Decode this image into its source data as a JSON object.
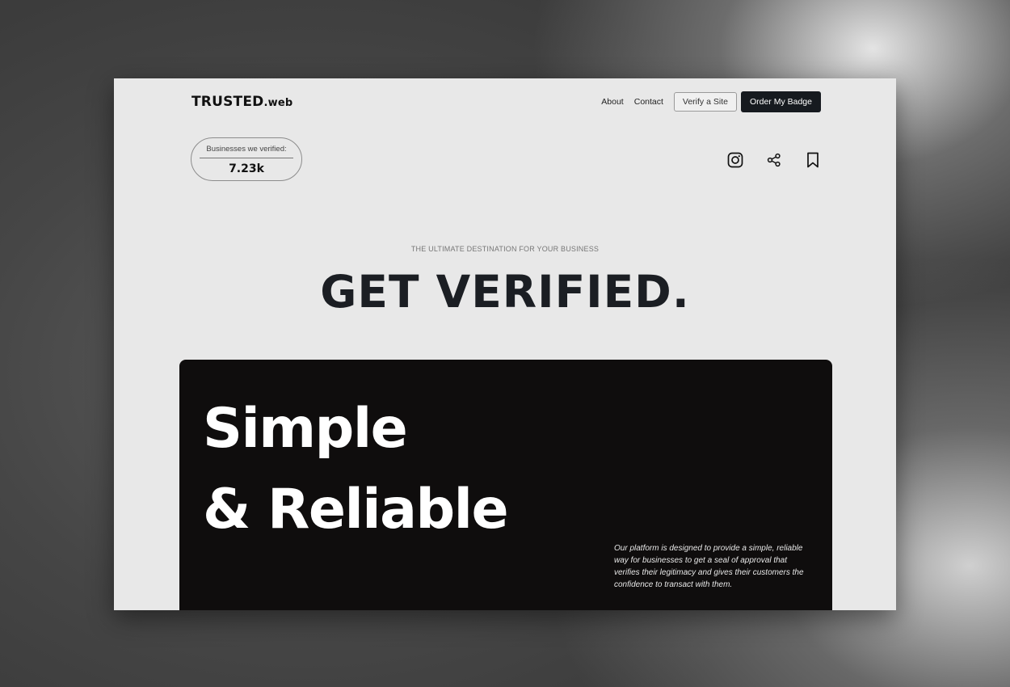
{
  "header": {
    "logo_main": "TRUSTED",
    "logo_suffix": ".web",
    "nav": {
      "about": "About",
      "contact": "Contact",
      "verify_button": "Verify a Site",
      "order_button": "Order My Badge"
    }
  },
  "stats": {
    "label": "Businesses we verified:",
    "value": "7.23k"
  },
  "social_icons": [
    "instagram-icon",
    "share-icon",
    "bookmark-icon"
  ],
  "hero": {
    "eyebrow": "THE ULTIMATE DESTINATION FOR YOUR BUSINESS",
    "headline": "GET VERIFIED.",
    "card_title_line1": "Simple",
    "card_title_line2": "& Reliable",
    "card_description": "Our platform is designed to provide a simple, reliable way for businesses to get a seal of approval that verifies their legitimacy and gives their customers the confidence to transact with them."
  },
  "colors": {
    "page_background": "#e8e8e8",
    "text_dark": "#1b1e23",
    "button_dark": "#161a1f",
    "card_background": "#0f0d0d"
  }
}
